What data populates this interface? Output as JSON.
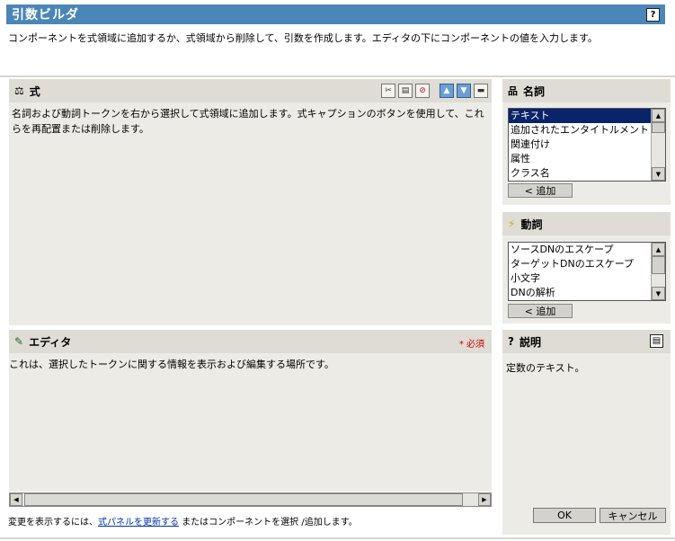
{
  "title": "引数ビルダ",
  "help_icon": "?",
  "intro": "コンポーネントを式領域に追加するか、式領域から削除して、引数を作成します。エディタの下にコンポーネントの値を入力します。",
  "expression": {
    "heading": "式",
    "description": "名詞および動詞トークンを右から選択して式領域に追加します。式キャプションのボタンを使用して、これらを再配置または削除します。"
  },
  "nouns": {
    "heading": "名詞",
    "items": [
      "テキスト",
      "追加されたエンタイトルメント",
      "関連付け",
      "属性",
      "クラス名"
    ],
    "selected": "テキスト",
    "add_label": "< 追加"
  },
  "verbs": {
    "heading": "動詞",
    "items": [
      "ソースDNのエスケープ",
      "ターゲットDNのエスケープ",
      "小文字",
      "DNの解析"
    ],
    "add_label": "< 追加"
  },
  "editor": {
    "heading": "エディタ",
    "required_label": "* 必須",
    "description": "これは、選択したトークンに関する情報を表示および編集する場所です。"
  },
  "explanation": {
    "heading": "説明",
    "text": "定数のテキスト。"
  },
  "footer": {
    "prefix": "変更を表示するには、",
    "link": "式パネルを更新する",
    "suffix": "またはコンポーネントを選択 /追加します。"
  },
  "buttons": {
    "ok": "OK",
    "cancel": "キャンセル"
  }
}
